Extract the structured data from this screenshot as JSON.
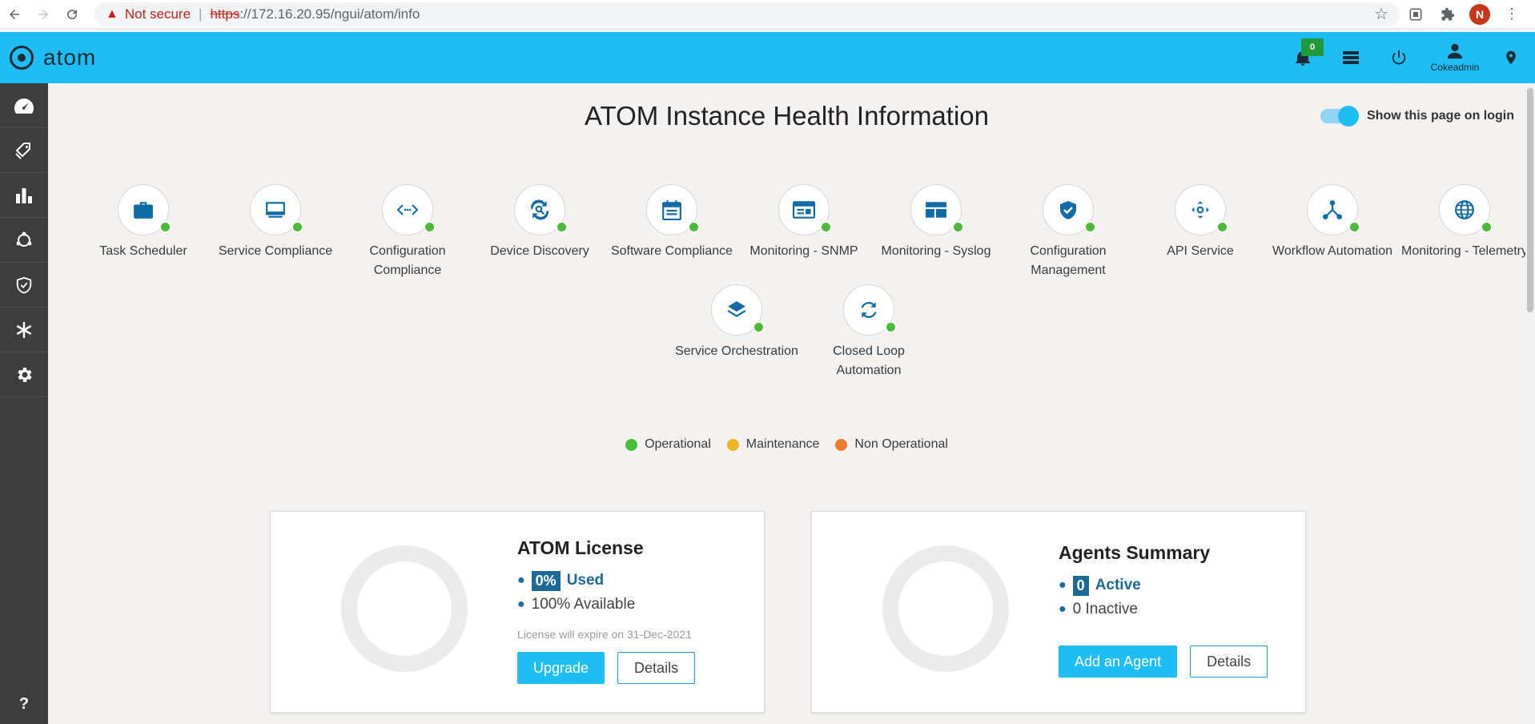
{
  "browser": {
    "security_label": "Not secure",
    "url_scheme": "https",
    "url_rest": "://172.16.20.95/ngui/atom/info",
    "profile_initial": "N"
  },
  "header": {
    "app_name": "atom",
    "notification_count": "0",
    "user_name": "Cokeadmin"
  },
  "page": {
    "title": "ATOM Instance Health Information",
    "login_toggle_label": "Show this page on login"
  },
  "services": [
    {
      "name": "Task Scheduler",
      "icon": "briefcase-icon",
      "status": "Operational"
    },
    {
      "name": "Service Compliance",
      "icon": "monitor-icon",
      "status": "Operational"
    },
    {
      "name": "Configuration Compliance",
      "icon": "code-arrows-icon",
      "status": "Operational"
    },
    {
      "name": "Device Discovery",
      "icon": "search-refresh-icon",
      "status": "Operational"
    },
    {
      "name": "Software Compliance",
      "icon": "calendar-icon",
      "status": "Operational"
    },
    {
      "name": "Monitoring - SNMP",
      "icon": "browser-window-icon",
      "status": "Operational"
    },
    {
      "name": "Monitoring - Syslog",
      "icon": "dashboard-panel-icon",
      "status": "Operational"
    },
    {
      "name": "Configuration Management",
      "icon": "shield-check-icon",
      "status": "Operational"
    },
    {
      "name": "API Service",
      "icon": "api-dots-icon",
      "status": "Operational"
    },
    {
      "name": "Workflow Automation",
      "icon": "workflow-icon",
      "status": "Operational"
    },
    {
      "name": "Monitoring - Telemetry",
      "icon": "globe-icon",
      "status": "Operational"
    },
    {
      "name": "Service Orchestration",
      "icon": "layers-icon",
      "status": "Operational"
    },
    {
      "name": "Closed Loop Automation",
      "icon": "sync-icon",
      "status": "Operational"
    }
  ],
  "legend": [
    {
      "label": "Operational",
      "color": "#4cbb3a"
    },
    {
      "label": "Maintenance",
      "color": "#f0b429"
    },
    {
      "label": "Non Operational",
      "color": "#ee7a30"
    }
  ],
  "license_card": {
    "title": "ATOM License",
    "used_value": "0%",
    "used_label": "Used",
    "available_text": "100% Available",
    "expiry_text": "License will expire on 31-Dec-2021",
    "upgrade_label": "Upgrade",
    "details_label": "Details"
  },
  "agents_card": {
    "title": "Agents Summary",
    "active_value": "0",
    "active_label": "Active",
    "inactive_text": "0 Inactive",
    "add_label": "Add an Agent",
    "details_label": "Details"
  },
  "sidebar": {
    "items": [
      "dashboard-gauge-icon",
      "tags-icon",
      "bar-chart-icon",
      "network-nodes-icon",
      "shield-icon",
      "snowflake-icon",
      "gear-icon"
    ],
    "help": "?"
  },
  "colors": {
    "header": "#1ebef5",
    "sidebar": "#3d3d3d",
    "accent_dark": "#1d6996",
    "operational": "#4cbb3a"
  }
}
